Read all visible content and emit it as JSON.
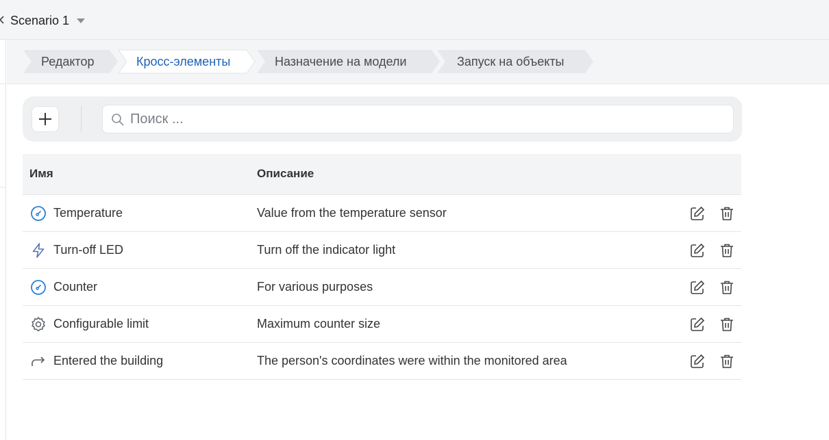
{
  "header": {
    "scenario_name": "Scenario 1",
    "icons": {
      "back": "chevron-left-icon",
      "dropdown": "caret-down-icon"
    }
  },
  "tabs": [
    {
      "label": "Редактор",
      "active": false
    },
    {
      "label": "Кросс-элементы",
      "active": true
    },
    {
      "label": "Назначение на модели",
      "active": false
    },
    {
      "label": "Запуск на объекты",
      "active": false
    }
  ],
  "toolbar": {
    "add_icon": "plus-icon",
    "search_placeholder": "Поиск ...",
    "search_value": ""
  },
  "table": {
    "columns": {
      "name": "Имя",
      "description": "Описание"
    },
    "rows": [
      {
        "icon": "gauge-icon",
        "name": "Temperature",
        "description": "Value from the temperature sensor"
      },
      {
        "icon": "lightning-icon",
        "name": "Turn-off LED",
        "description": "Turn off the indicator light"
      },
      {
        "icon": "gauge-icon",
        "name": "Counter",
        "description": "For various purposes"
      },
      {
        "icon": "gear-icon",
        "name": "Configurable limit",
        "description": "Maximum counter size"
      },
      {
        "icon": "arrow-forward-icon",
        "name": "Entered the building",
        "description": "The person's coordinates were within the monitored area"
      }
    ],
    "row_actions": {
      "edit_icon": "edit-icon",
      "delete_icon": "trash-icon"
    }
  },
  "colors": {
    "accent": "#1e63b8",
    "gauge_icon": "#2f7fd1",
    "lightning_icon": "#5b74b8",
    "muted_icon": "#5a5f66",
    "tab_fill": "#e6e8eb",
    "tab_active_fill": "#ffffff"
  }
}
